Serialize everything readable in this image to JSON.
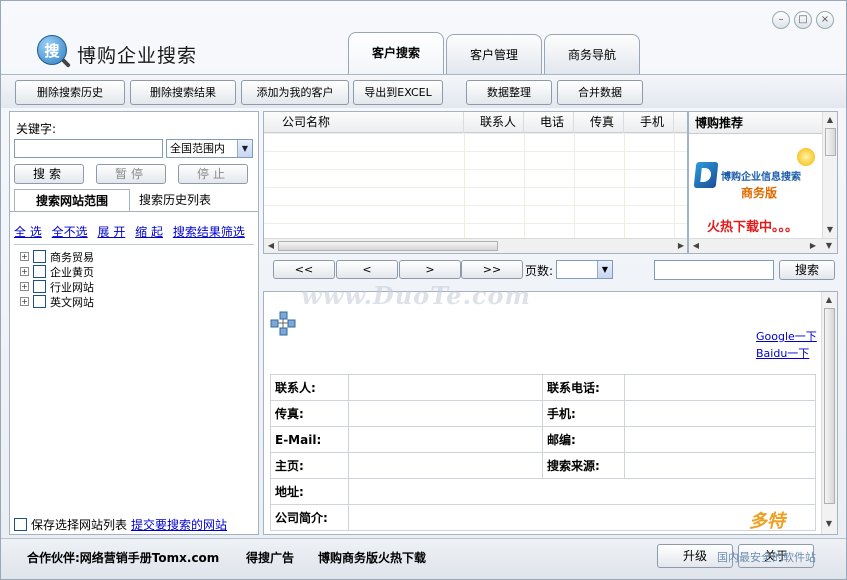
{
  "app": {
    "title": "博购企业搜索",
    "logo_glyph": "搜",
    "window_controls": [
      "–",
      "□",
      "×"
    ]
  },
  "tabs": [
    {
      "label": "客户搜索",
      "active": true
    },
    {
      "label": "客户管理",
      "active": false
    },
    {
      "label": "商务导航",
      "active": false
    }
  ],
  "toolbar": {
    "clear_history": "删除搜索历史",
    "clear_results": "删除搜索结果",
    "add_customer": "添加为我的客户",
    "export_excel": "导出到EXCEL",
    "organize": "数据整理",
    "merge": "合并数据"
  },
  "search": {
    "keyword_label": "关键字:",
    "keyword_value": "",
    "scope_value": "全国范围内",
    "search_btn": "搜索",
    "pause_btn": "暂停",
    "stop_btn": "停止"
  },
  "left_tabs": {
    "site_scope": "搜索网站范围",
    "history": "搜索历史列表"
  },
  "links": {
    "select_all": "全 选",
    "select_none": "全不选",
    "expand": "展 开",
    "collapse": "缩 起",
    "filter": "搜索结果筛选"
  },
  "tree": [
    {
      "label": "商务贸易"
    },
    {
      "label": "企业黄页"
    },
    {
      "label": "行业网站"
    },
    {
      "label": "英文网站"
    }
  ],
  "save": {
    "label": "保存选择网站列表",
    "submit_link": "提交要搜索的网站"
  },
  "grid": {
    "columns": [
      "公司名称",
      "联系人",
      "电话",
      "传真",
      "手机"
    ]
  },
  "recommend": {
    "title": "博购推荐",
    "product": "博购企业信息搜索",
    "edition": "商务版",
    "hot": "火热下载中。。。"
  },
  "pager": {
    "first": "<<",
    "prev": "<",
    "next": ">",
    "last": ">>",
    "page_label": "页数:",
    "page_value": "",
    "search_btn": "搜索"
  },
  "detail": {
    "google": "Google一下",
    "baidu": "Baidu一下",
    "contact_label": "联系人:",
    "phone_label": "联系电话:",
    "fax_label": "传真:",
    "mobile_label": "手机:",
    "email_label": "E-Mail:",
    "zip_label": "邮编:",
    "homepage_label": "主页:",
    "source_label": "搜索来源:",
    "address_label": "地址:",
    "intro_label": "公司简介:"
  },
  "footer": {
    "partner": "合作伙伴:网络营销手册Tomx.com",
    "ad": "得搜广告",
    "promo": "博购商务版火热下载",
    "upgrade_btn": "升级",
    "about_btn": "关于"
  },
  "watermark": {
    "text": "www.DuoTe.com",
    "brand": "多特",
    "brand_sub": "国内最安全的软件站"
  },
  "colors": {
    "link": "#0000cc",
    "hot": "#e21b1b",
    "edition": "#e06a00",
    "border": "#a7b2c0"
  }
}
